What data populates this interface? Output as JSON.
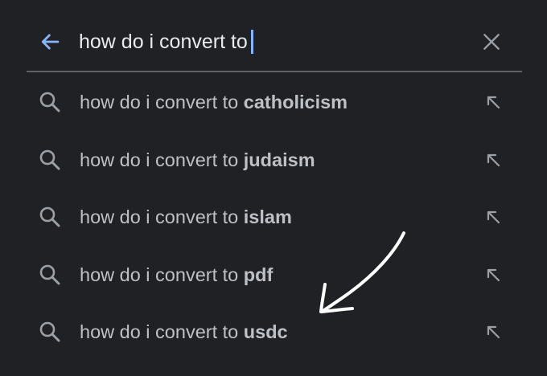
{
  "search": {
    "query": "how do i convert to",
    "back_icon": "arrow-left-icon",
    "clear_icon": "close-icon"
  },
  "colors": {
    "background": "#202124",
    "accent": "#8ab4f8",
    "text": "#e8eaed",
    "muted_text": "#bdc1c6",
    "icon": "#9aa0a6",
    "divider": "#5f6368"
  },
  "suggestions": [
    {
      "prefix": "how do i convert to ",
      "completion": "catholicism",
      "icon": "search-icon",
      "action_icon": "arrow-up-left-icon"
    },
    {
      "prefix": "how do i convert to ",
      "completion": "judaism",
      "icon": "search-icon",
      "action_icon": "arrow-up-left-icon"
    },
    {
      "prefix": "how do i convert to ",
      "completion": "islam",
      "icon": "search-icon",
      "action_icon": "arrow-up-left-icon"
    },
    {
      "prefix": "how do i convert to ",
      "completion": "pdf",
      "icon": "search-icon",
      "action_icon": "arrow-up-left-icon"
    },
    {
      "prefix": "how do i convert to ",
      "completion": "usdc",
      "icon": "search-icon",
      "action_icon": "arrow-up-left-icon"
    }
  ],
  "annotation": {
    "type": "hand-drawn-arrow",
    "points_to": "usdc"
  }
}
